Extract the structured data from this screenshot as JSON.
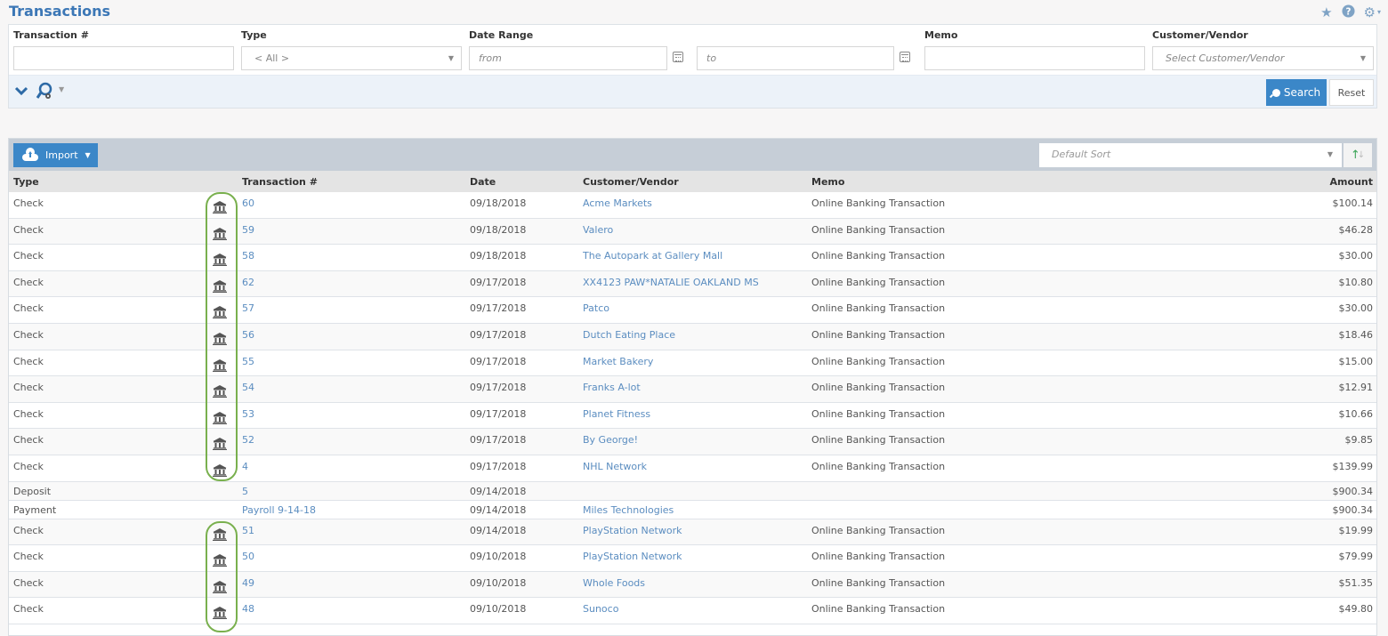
{
  "page": {
    "title": "Transactions",
    "top_icons": [
      "star-icon",
      "help-icon",
      "gear-icon"
    ]
  },
  "filters": {
    "transaction_no": {
      "label": "Transaction #",
      "value": ""
    },
    "type": {
      "label": "Type",
      "value": "< All >"
    },
    "date_range": {
      "label": "Date Range",
      "from_placeholder": "from",
      "to_placeholder": "to"
    },
    "memo": {
      "label": "Memo",
      "value": ""
    },
    "customer_vendor": {
      "label": "Customer/Vendor",
      "placeholder": "Select Customer/Vendor"
    },
    "search_label": "Search",
    "reset_label": "Reset"
  },
  "grid": {
    "import_label": "Import",
    "sort_placeholder": "Default Sort",
    "columns": {
      "type": "Type",
      "transaction_no": "Transaction #",
      "date": "Date",
      "customer_vendor": "Customer/Vendor",
      "memo": "Memo",
      "amount": "Amount"
    },
    "rows": [
      {
        "type": "Check",
        "bank": true,
        "txn": "60",
        "date": "09/18/2018",
        "cust": "Acme Markets",
        "memo": "Online Banking Transaction",
        "amount": "$100.14"
      },
      {
        "type": "Check",
        "bank": true,
        "txn": "59",
        "date": "09/18/2018",
        "cust": "Valero",
        "memo": "Online Banking Transaction",
        "amount": "$46.28"
      },
      {
        "type": "Check",
        "bank": true,
        "txn": "58",
        "date": "09/18/2018",
        "cust": "The Autopark at Gallery Mall",
        "memo": "Online Banking Transaction",
        "amount": "$30.00"
      },
      {
        "type": "Check",
        "bank": true,
        "txn": "62",
        "date": "09/17/2018",
        "cust": "XX4123 PAW*NATALIE OAKLAND MS",
        "memo": "Online Banking Transaction",
        "amount": "$10.80"
      },
      {
        "type": "Check",
        "bank": true,
        "txn": "57",
        "date": "09/17/2018",
        "cust": "Patco",
        "memo": "Online Banking Transaction",
        "amount": "$30.00"
      },
      {
        "type": "Check",
        "bank": true,
        "txn": "56",
        "date": "09/17/2018",
        "cust": "Dutch Eating Place",
        "memo": "Online Banking Transaction",
        "amount": "$18.46"
      },
      {
        "type": "Check",
        "bank": true,
        "txn": "55",
        "date": "09/17/2018",
        "cust": "Market Bakery",
        "memo": "Online Banking Transaction",
        "amount": "$15.00"
      },
      {
        "type": "Check",
        "bank": true,
        "txn": "54",
        "date": "09/17/2018",
        "cust": "Franks A-lot",
        "memo": "Online Banking Transaction",
        "amount": "$12.91"
      },
      {
        "type": "Check",
        "bank": true,
        "txn": "53",
        "date": "09/17/2018",
        "cust": "Planet Fitness",
        "memo": "Online Banking Transaction",
        "amount": "$10.66"
      },
      {
        "type": "Check",
        "bank": true,
        "txn": "52",
        "date": "09/17/2018",
        "cust": "By George!",
        "memo": "Online Banking Transaction",
        "amount": "$9.85"
      },
      {
        "type": "Check",
        "bank": true,
        "txn": "4",
        "date": "09/17/2018",
        "cust": "NHL Network",
        "memo": "Online Banking Transaction",
        "amount": "$139.99"
      },
      {
        "type": "Deposit",
        "bank": false,
        "txn": "5",
        "date": "09/14/2018",
        "cust": "",
        "memo": "",
        "amount": "$900.34"
      },
      {
        "type": "Payment",
        "bank": false,
        "txn": "Payroll 9-14-18",
        "date": "09/14/2018",
        "cust": "Miles Technologies",
        "memo": "",
        "amount": "$900.34"
      },
      {
        "type": "Check",
        "bank": true,
        "txn": "51",
        "date": "09/14/2018",
        "cust": "PlayStation Network",
        "memo": "Online Banking Transaction",
        "amount": "$19.99"
      },
      {
        "type": "Check",
        "bank": true,
        "txn": "50",
        "date": "09/10/2018",
        "cust": "PlayStation Network",
        "memo": "Online Banking Transaction",
        "amount": "$79.99"
      },
      {
        "type": "Check",
        "bank": true,
        "txn": "49",
        "date": "09/10/2018",
        "cust": "Whole Foods",
        "memo": "Online Banking Transaction",
        "amount": "$51.35"
      },
      {
        "type": "Check",
        "bank": true,
        "txn": "48",
        "date": "09/10/2018",
        "cust": "Sunoco",
        "memo": "Online Banking Transaction",
        "amount": "$49.80"
      }
    ]
  },
  "colors": {
    "accent": "#3b87c8",
    "title": "#3c77b6",
    "link": "#5b8dc0",
    "highlight_outline": "#79b04e"
  }
}
